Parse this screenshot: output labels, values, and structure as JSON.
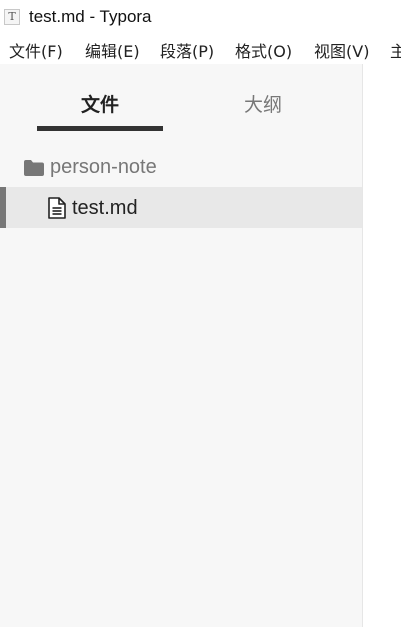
{
  "window": {
    "icon_letter": "T",
    "title": "test.md - Typora"
  },
  "menubar": {
    "items": [
      {
        "label": "文件(F)"
      },
      {
        "label": "编辑(E)"
      },
      {
        "label": "段落(P)"
      },
      {
        "label": "格式(O)"
      },
      {
        "label": "视图(V)"
      },
      {
        "label": "主"
      }
    ]
  },
  "sidebar": {
    "tabs": [
      {
        "label": "文件",
        "active": true
      },
      {
        "label": "大纲",
        "active": false
      }
    ],
    "tree": {
      "folder": {
        "name": "person-note",
        "icon": "folder-icon"
      },
      "files": [
        {
          "name": "test.md",
          "icon": "file-icon",
          "selected": true
        }
      ]
    }
  },
  "colors": {
    "sidebar_bg": "#f7f7f7",
    "selected_row_bg": "#e8e8e8",
    "tab_underline": "#333333",
    "muted_text": "#777777"
  }
}
